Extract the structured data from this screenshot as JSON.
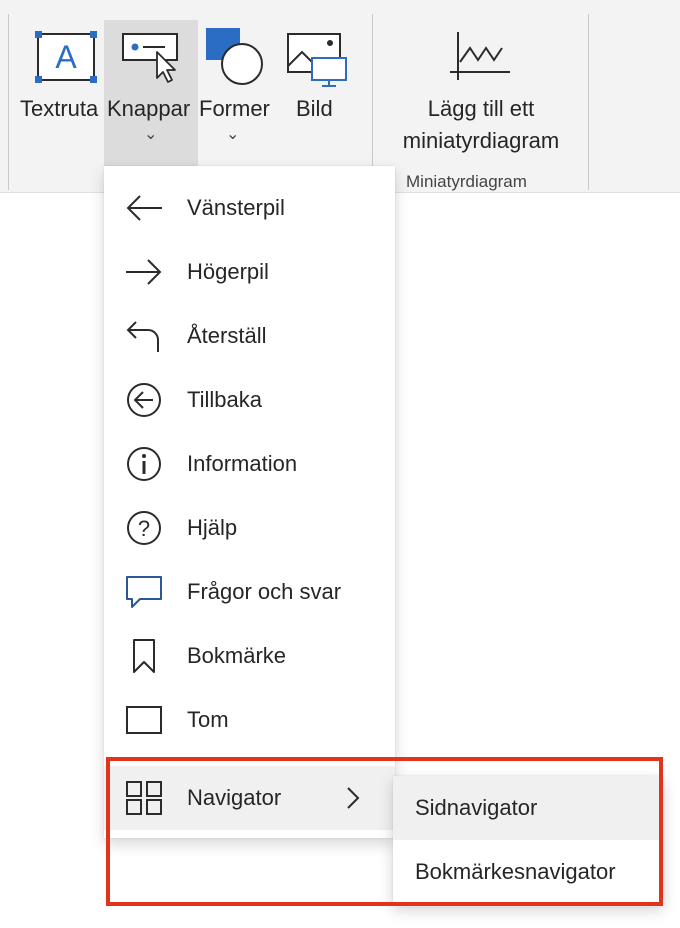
{
  "ribbon": {
    "buttons": [
      {
        "label": "Textruta",
        "icon": "textbox-icon"
      },
      {
        "label": "Knappar",
        "icon": "button-control-icon",
        "caret": "⌄",
        "active": true
      },
      {
        "label": "Former",
        "icon": "shapes-icon",
        "caret": "⌄"
      },
      {
        "label": "Bild",
        "icon": "picture-icon"
      }
    ],
    "sparkline": {
      "label_line1": "Lägg till ett",
      "label_line2": "miniatyrdiagram",
      "icon": "sparkline-icon"
    },
    "group_label": "Miniatyrdiagram"
  },
  "menu": {
    "items": [
      {
        "label": "Vänsterpil",
        "icon": "arrow-left-icon"
      },
      {
        "label": "Högerpil",
        "icon": "arrow-right-icon"
      },
      {
        "label": "Återställ",
        "icon": "reset-icon"
      },
      {
        "label": "Tillbaka",
        "icon": "back-circle-icon"
      },
      {
        "label": "Information",
        "icon": "info-icon"
      },
      {
        "label": "Hjälp",
        "icon": "help-icon"
      },
      {
        "label": "Frågor och svar",
        "icon": "qa-icon"
      },
      {
        "label": "Bokmärke",
        "icon": "bookmark-icon"
      },
      {
        "label": "Tom",
        "icon": "blank-icon"
      },
      {
        "label": "Navigator",
        "icon": "navigator-icon",
        "has_submenu": true
      }
    ]
  },
  "submenu": {
    "items": [
      {
        "label": "Sidnavigator",
        "highlighted": true
      },
      {
        "label": "Bokmärkesnavigator"
      }
    ]
  },
  "colors": {
    "accent": "#2b579a",
    "highlight_box": "#e0341f",
    "menu_hover": "#f0f0f0",
    "ribbon_bg": "#f3f3f3"
  }
}
